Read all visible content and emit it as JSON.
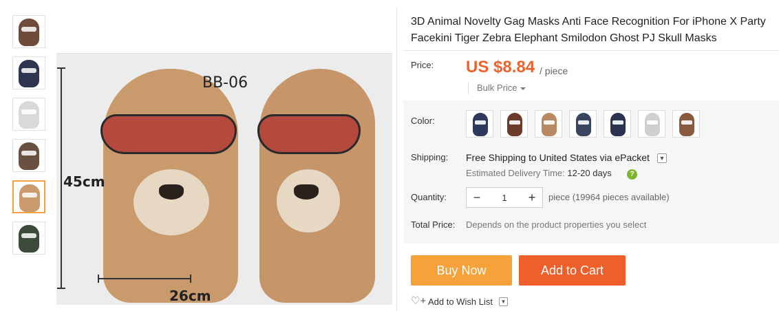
{
  "gallery": {
    "thumbnails": [
      {
        "name": "thumb-1",
        "color": "#6e4b3a"
      },
      {
        "name": "thumb-2",
        "color": "#2e3550"
      },
      {
        "name": "thumb-3",
        "color": "#d9d9d9"
      },
      {
        "name": "thumb-4",
        "color": "#6a5040"
      },
      {
        "name": "thumb-5",
        "color": "#c99a6c",
        "active": true
      },
      {
        "name": "thumb-6",
        "color": "#3d4b3a"
      }
    ],
    "main_image": {
      "code": "BB-06",
      "height_label": "45cm",
      "width_label": "26cm"
    }
  },
  "product": {
    "title": "3D Animal Novelty Gag Masks Anti Face Recognition For iPhone X Party Facekini Tiger Zebra Elephant Smilodon Ghost PJ Skull Masks"
  },
  "price": {
    "label": "Price:",
    "value": "US $8.84",
    "unit": "/ piece",
    "bulk_label": "Bulk Price"
  },
  "color": {
    "label": "Color:",
    "swatches": [
      {
        "name": "color-1",
        "color": "#2e3a5c"
      },
      {
        "name": "color-2",
        "color": "#6b3a2a"
      },
      {
        "name": "color-3",
        "color": "#b98a62"
      },
      {
        "name": "color-4",
        "color": "#3a4560"
      },
      {
        "name": "color-5",
        "color": "#2a3350"
      },
      {
        "name": "color-6",
        "color": "#cfcfcf"
      },
      {
        "name": "color-7",
        "color": "#8a5a3e"
      }
    ]
  },
  "shipping": {
    "label": "Shipping:",
    "text": "Free Shipping to United States via ePacket",
    "delivery_prefix": "Estimated Delivery Time:",
    "delivery_days": "12-20 days",
    "help_icon": "question-icon"
  },
  "quantity": {
    "label": "Quantity:",
    "value": "1",
    "availability": "piece (19964 pieces available)"
  },
  "total": {
    "label": "Total Price:",
    "text": "Depends on the product properties you select"
  },
  "actions": {
    "buy_now": "Buy Now",
    "add_to_cart": "Add to Cart",
    "wish_list": "Add to Wish List"
  },
  "colors": {
    "accent_price": "#f0622b",
    "buy_now_bg": "#f7a13a",
    "add_to_cart_bg": "#ef5f2a"
  }
}
